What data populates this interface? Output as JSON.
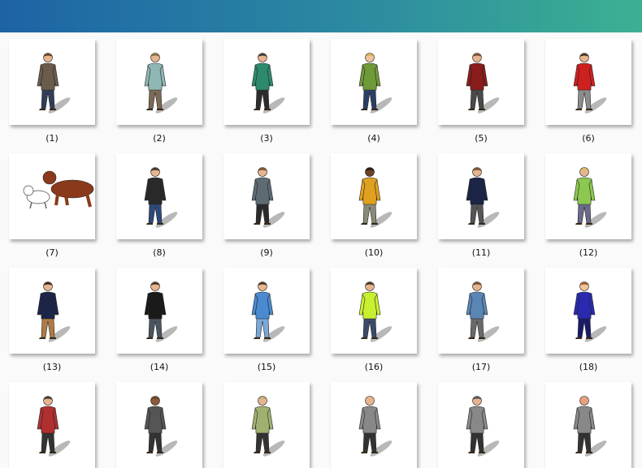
{
  "header": {
    "accent_start": "#1d63a5",
    "accent_end": "#3cb092"
  },
  "gallery": {
    "items": [
      {
        "label": "(1)",
        "icon": "standing-man-brown-jacket",
        "top": "#6b5b4a",
        "bottom": "#2f3e5a",
        "skin": "#e6b48f",
        "hair": "#5a3b22"
      },
      {
        "label": "(2)",
        "icon": "standing-man-hands-in-pockets",
        "top": "#8fb7b4",
        "bottom": "#7a6a55",
        "skin": "#e6b48f",
        "hair": "#8a6a40"
      },
      {
        "label": "(3)",
        "icon": "cyclist-drinking",
        "top": "#2e8a6e",
        "bottom": "#2c2c2c",
        "skin": "#e6b48f",
        "hair": "#333333"
      },
      {
        "label": "(4)",
        "icon": "woman-green-coat",
        "top": "#6f9a3a",
        "bottom": "#2b3f66",
        "skin": "#f0c49a",
        "hair": "#d7b24a"
      },
      {
        "label": "(5)",
        "icon": "man-red-sweater",
        "top": "#8a1c1c",
        "bottom": "#4a4a4a",
        "skin": "#e6b48f",
        "hair": "#6e4a2e"
      },
      {
        "label": "(6)",
        "icon": "man-red-shirt-arms-out",
        "top": "#cf2020",
        "bottom": "#8c8c8c",
        "skin": "#e6b48f",
        "hair": "#3a2a1a"
      },
      {
        "label": "(7)",
        "icon": "dogs-playing",
        "top": "#8a3a1a",
        "bottom": "#ffffff",
        "skin": "#e6b48f",
        "hair": "#3a2a1a"
      },
      {
        "label": "(8)",
        "icon": "man-black-jacket",
        "top": "#2a2a2a",
        "bottom": "#2c4a7a",
        "skin": "#e6b48f",
        "hair": "#2a2a2a"
      },
      {
        "label": "(9)",
        "icon": "man-grey-shirt",
        "top": "#5f6b72",
        "bottom": "#2a2a2a",
        "skin": "#e6b48f",
        "hair": "#6e4a2e"
      },
      {
        "label": "(10)",
        "icon": "man-yellow-jacket",
        "top": "#e0a020",
        "bottom": "#8a8a7a",
        "skin": "#6b4328",
        "hair": "#2a1a10"
      },
      {
        "label": "(11)",
        "icon": "man-navy-sweater",
        "top": "#1c2548",
        "bottom": "#555555",
        "skin": "#e6b48f",
        "hair": "#6e4a2e"
      },
      {
        "label": "(12)",
        "icon": "surveyor-with-tripod",
        "top": "#8cc850",
        "bottom": "#6a6a8a",
        "skin": "#e6b48f",
        "hair": "#d7c05a"
      },
      {
        "label": "(13)",
        "icon": "bearded-man-navy-sweater",
        "top": "#1c2548",
        "bottom": "#b07a45",
        "skin": "#e6b48f",
        "hair": "#2a1a10"
      },
      {
        "label": "(14)",
        "icon": "man-black-tshirt",
        "top": "#1a1a1a",
        "bottom": "#4a5560",
        "skin": "#e6b48f",
        "hair": "#3a2a1a"
      },
      {
        "label": "(15)",
        "icon": "man-sitting-stool",
        "top": "#4a8ad0",
        "bottom": "#7aa8d8",
        "skin": "#e6b48f",
        "hair": "#3a2a1a"
      },
      {
        "label": "(16)",
        "icon": "surveyor-hi-vis",
        "top": "#c8f030",
        "bottom": "#3a4a6a",
        "skin": "#e6b48f",
        "hair": "#3a2a1a"
      },
      {
        "label": "(17)",
        "icon": "man-denim-jacket",
        "top": "#5a86b5",
        "bottom": "#6a6a6a",
        "skin": "#e6b48f",
        "hair": "#6e4a2e"
      },
      {
        "label": "(18)",
        "icon": "woman-blue-top",
        "top": "#2a2ab0",
        "bottom": "#1a1a6a",
        "skin": "#f0c49a",
        "hair": "#a0521e"
      },
      {
        "label": "",
        "icon": "person-partial",
        "top": "#b03030",
        "bottom": "#333333",
        "skin": "#e6b48f",
        "hair": "#333333"
      },
      {
        "label": "",
        "icon": "person-with-hat-partial",
        "top": "#555555",
        "bottom": "#333333",
        "skin": "#8a5a3a",
        "hair": "#6a4a2a"
      },
      {
        "label": "",
        "icon": "person-partial",
        "top": "#a0b070",
        "bottom": "#333333",
        "skin": "#e6b48f",
        "hair": "#c0b070"
      },
      {
        "label": "",
        "icon": "bald-person-partial",
        "top": "#888888",
        "bottom": "#333333",
        "skin": "#e6b48f",
        "hair": "#e6b48f"
      },
      {
        "label": "",
        "icon": "person-partial",
        "top": "#888888",
        "bottom": "#333333",
        "skin": "#e6b48f",
        "hair": "#555555"
      },
      {
        "label": "",
        "icon": "person-partial",
        "top": "#888888",
        "bottom": "#333333",
        "skin": "#e6a080",
        "hair": "#e6a080"
      }
    ]
  }
}
